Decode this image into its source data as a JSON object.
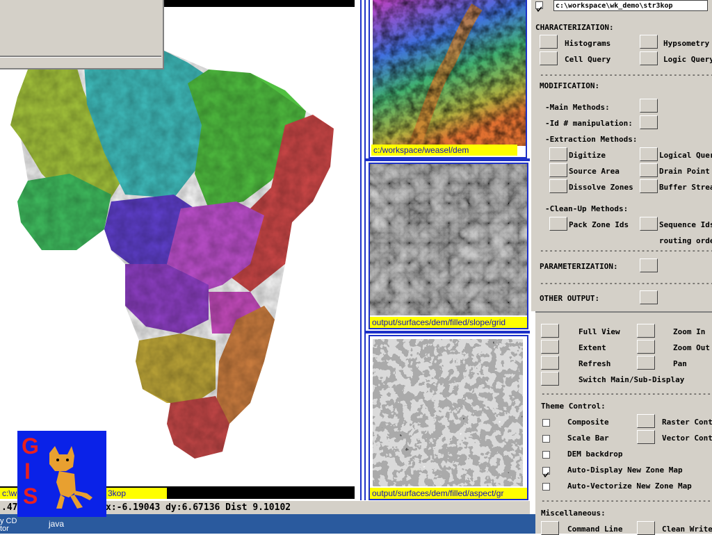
{
  "colors": {
    "panel": "#d4d0c8",
    "label_bar": "#ffff00",
    "label_text": "#1010c0",
    "frame_blue": "#1c30c8",
    "taskbar": "#2a5a9e"
  },
  "main_map": {
    "label_prefix": "c:\\wor",
    "label_suffix": "3kop",
    "status_text": ".47",
    "status_coords": "x:-6.19043 dy:6.67136 Dist 9.10102"
  },
  "gis_logo": {
    "letters": [
      "G",
      "I",
      "S"
    ],
    "caption": "java",
    "taskbar_left_line1": "y CD",
    "taskbar_left_line2": "tor"
  },
  "thumbnails": [
    {
      "label": "c:/workspace/weasel/dem"
    },
    {
      "label": "output/surfaces/dem/filled/slope/grid"
    },
    {
      "label": "output/surfaces/dem/filled/aspect/gr"
    }
  ],
  "panel": {
    "path_value": "c:\\workspace\\wk_demo\\str3kop",
    "characterization": "CHARACTERIZATION:",
    "histograms": "Histograms",
    "hypsometry": "Hypsometry",
    "cell_query": "Cell Query",
    "logic_query": "Logic Query",
    "separator": "----------------------------------------------",
    "modification": "MODIFICATION:",
    "main_methods": "-Main Methods:",
    "id_manip": "-Id # manipulation:",
    "extraction": "-Extraction Methods:",
    "digitize": "Digitize",
    "logical_query": "Logical Query",
    "source_area": "Source Area",
    "drain_point": "Drain Point",
    "dissolve": "Dissolve Zones",
    "buffer": "Buffer Stream",
    "cleanup": "-Clean-Up Methods:",
    "pack_zone": "Pack Zone Ids",
    "sequence_ids": "Sequence Ids",
    "routing_order": "routing order",
    "parameterization": "PARAMETERIZATION:",
    "other_output": "OTHER OUTPUT:"
  },
  "lower_panel": {
    "full_view": "Full View",
    "zoom_in": "Zoom In",
    "extent": "Extent",
    "zoom_out": "Zoom Out",
    "refresh": "Refresh",
    "pan": "Pan",
    "switch_display": "Switch Main/Sub-Display",
    "separator": "---------------------------------------------",
    "theme_control": "Theme Control:",
    "composite": "Composite",
    "raster_control": "Raster Control",
    "scale_bar": "Scale Bar",
    "vector_control": "Vector Control",
    "dem_backdrop": "DEM backdrop",
    "auto_display": "Auto-Display New Zone Map",
    "auto_vectorize": "Auto-Vectorize New Zone Map",
    "miscellaneous": "Miscellaneous:",
    "command_line": "Command Line",
    "clean_write": "Clean Write",
    "checked": {
      "composite": false,
      "scale_bar": false,
      "dem_backdrop": false,
      "auto_display": true,
      "auto_vectorize": false
    }
  }
}
